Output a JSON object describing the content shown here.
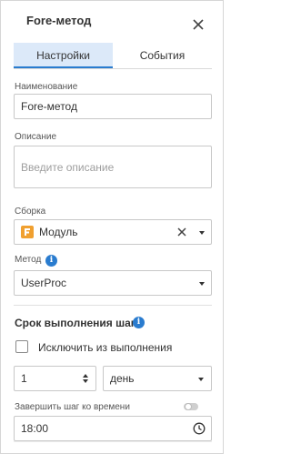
{
  "header": {
    "title": "Fore-метод",
    "close_icon": "close-icon"
  },
  "tabs": [
    {
      "label": "Настройки",
      "active": true
    },
    {
      "label": "События",
      "active": false
    }
  ],
  "name": {
    "label": "Наименование",
    "value": "Fore-метод"
  },
  "description": {
    "label": "Описание",
    "placeholder": "Введите описание",
    "value": ""
  },
  "assembly": {
    "label": "Сборка",
    "value": "Модуль",
    "icon": "fore-module-icon",
    "icon_color": "#f0a030"
  },
  "method": {
    "label": "Метод",
    "value": "UserProc"
  },
  "execution": {
    "title": "Срок выполнения шага",
    "exclude_label": "Исключить из выполнения",
    "exclude_checked": false,
    "amount": "1",
    "unit": "день",
    "finish_label": "Завершить шаг ко времени",
    "finish_enabled": false,
    "time": "18:00"
  },
  "colors": {
    "accent": "#2a7ccf",
    "tab_active_bg": "#dce9f9"
  }
}
